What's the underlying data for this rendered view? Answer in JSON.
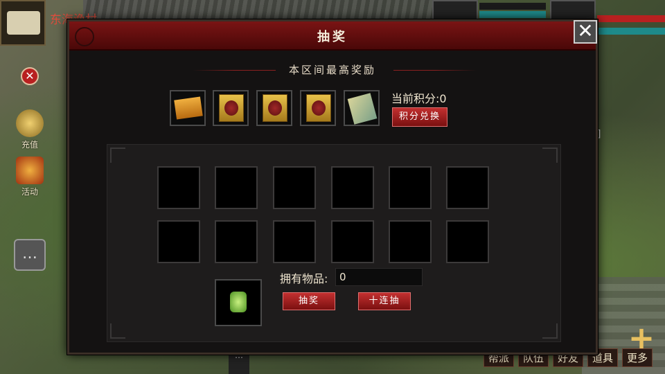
{
  "location": {
    "name": "东海渔村"
  },
  "side_buttons": [
    {
      "label": "充值",
      "icon": "coins-icon"
    },
    {
      "label": "活动",
      "icon": "gift-icon"
    }
  ],
  "bottom_menu": [
    "帮派",
    "队伍",
    "好友",
    "道具",
    "更多"
  ],
  "right_fragment": "]",
  "dialog": {
    "title": "抽奖",
    "close_symbol": "✕",
    "section_title": "本区间最高奖励",
    "rewards": [
      "box-icon",
      "gold-card-icon",
      "gold-card-icon",
      "gold-card-icon",
      "book-icon"
    ],
    "points_label": "当前积分:0",
    "exchange_button": "积分兑换",
    "grid_rows": 2,
    "grid_cols": 6,
    "own_items_label": "拥有物品:",
    "own_items_value": "0",
    "draw_button": "抽奖",
    "ten_draw_button": "十连抽"
  },
  "colors": {
    "title_red": "#7a1414",
    "button_red": "#c23030",
    "location_red": "#e04c3c"
  }
}
